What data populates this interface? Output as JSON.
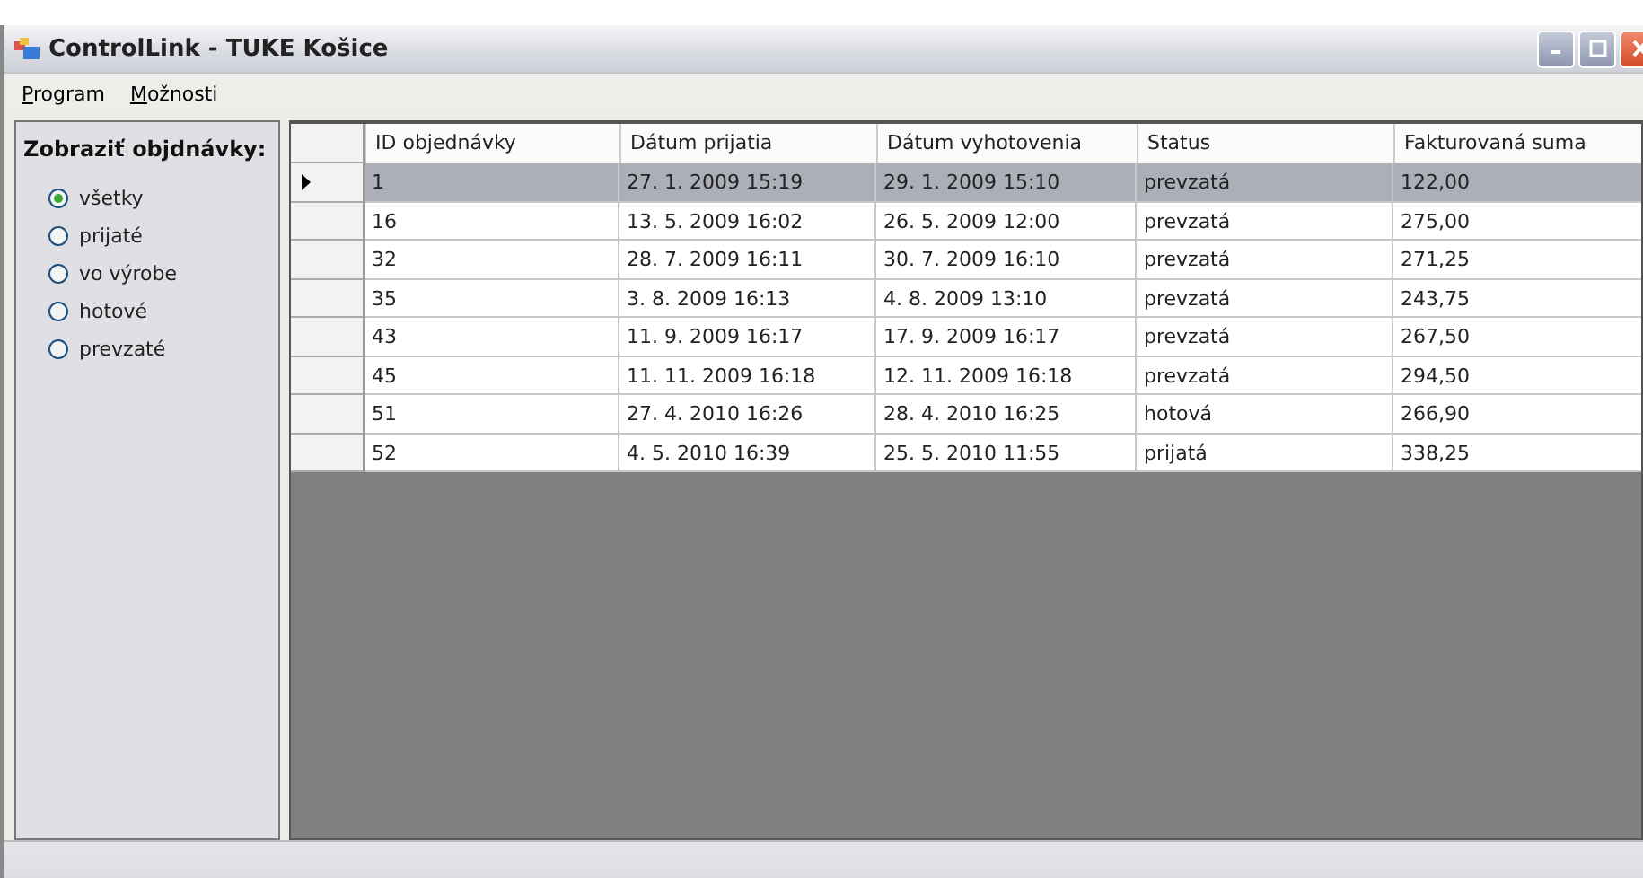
{
  "window": {
    "title": "ControlLink - TUKE Košice"
  },
  "menu": [
    "Program",
    "Možnosti"
  ],
  "filter": {
    "title": "Zobraziť objdnávky:",
    "options": [
      {
        "label": "všetky",
        "selected": true
      },
      {
        "label": "prijaté",
        "selected": false
      },
      {
        "label": "vo výrobe",
        "selected": false
      },
      {
        "label": "hotové",
        "selected": false
      },
      {
        "label": "prevzaté",
        "selected": false
      }
    ]
  },
  "table": {
    "columns": [
      "ID objednávky",
      "Dátum prijatia",
      "Dátum vyhotovenia",
      "Status",
      "Fakturovaná suma"
    ],
    "rows": [
      {
        "selected": true,
        "cells": [
          "1",
          "27. 1. 2009 15:19",
          "29. 1. 2009 15:10",
          "prevzatá",
          "122,00"
        ]
      },
      {
        "selected": false,
        "cells": [
          "16",
          "13. 5. 2009 16:02",
          "26. 5. 2009 12:00",
          "prevzatá",
          "275,00"
        ]
      },
      {
        "selected": false,
        "cells": [
          "32",
          "28. 7. 2009 16:11",
          "30. 7. 2009 16:10",
          "prevzatá",
          "271,25"
        ]
      },
      {
        "selected": false,
        "cells": [
          "35",
          "3. 8. 2009 16:13",
          "4. 8. 2009 13:10",
          "prevzatá",
          "243,75"
        ]
      },
      {
        "selected": false,
        "cells": [
          "43",
          "11. 9. 2009 16:17",
          "17. 9. 2009 16:17",
          "prevzatá",
          "267,50"
        ]
      },
      {
        "selected": false,
        "cells": [
          "45",
          "11. 11. 2009 16:18",
          "12. 11. 2009 16:18",
          "prevzatá",
          "294,50"
        ]
      },
      {
        "selected": false,
        "cells": [
          "51",
          "27. 4. 2010 16:26",
          "28. 4. 2010 16:25",
          "hotová",
          "266,90"
        ]
      },
      {
        "selected": false,
        "cells": [
          "52",
          "4. 5. 2010 16:39",
          "25. 5. 2010 11:55",
          "prijatá",
          "338,25"
        ]
      }
    ]
  }
}
